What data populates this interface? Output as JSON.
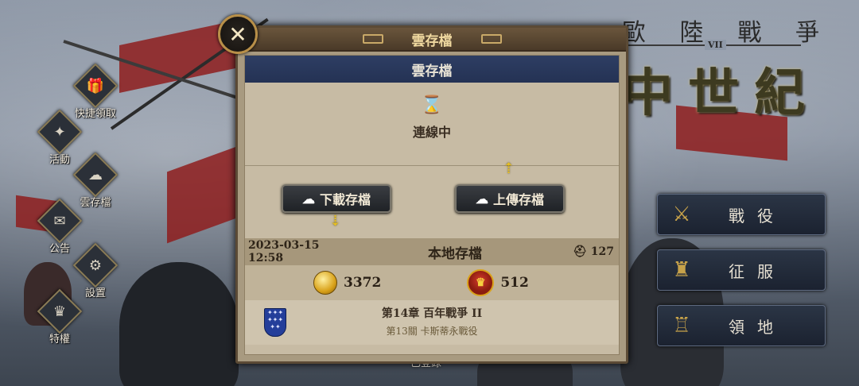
{
  "logo": {
    "subtitle_chars": [
      "歐",
      "陸",
      "戰",
      "爭"
    ],
    "numeral": "VII",
    "main_chars": [
      "中",
      "世",
      "紀"
    ]
  },
  "side_menu": [
    {
      "label": "快捷領取",
      "icon": "gift-icon",
      "glyph": "🎁"
    },
    {
      "label": "活動",
      "icon": "bag-icon",
      "glyph": "✦"
    },
    {
      "label": "雲存檔",
      "icon": "cloud-upload-icon",
      "glyph": "☁"
    },
    {
      "label": "公告",
      "icon": "envelope-icon",
      "glyph": "✉"
    },
    {
      "label": "設置",
      "icon": "gear-icon",
      "glyph": "⚙"
    },
    {
      "label": "特權",
      "icon": "crown-icon",
      "glyph": "♛"
    }
  ],
  "right_buttons": [
    {
      "label": "戰役",
      "icon": "crossed-swords-icon",
      "glyph": "⚔"
    },
    {
      "label": "征服",
      "icon": "cannon-icon",
      "glyph": "♜"
    },
    {
      "label": "領地",
      "icon": "castle-icon",
      "glyph": "♖"
    }
  ],
  "panel": {
    "header_title": "雲存檔",
    "cloud_bar_title": "雲存檔",
    "status_icon": "hourglass-icon",
    "status_text": "連線中",
    "download_label": "下載存檔",
    "upload_label": "上傳存檔",
    "local": {
      "date": "2023-03-15 12:58",
      "title": "本地存檔",
      "count": "127",
      "coins": "3372",
      "medals": "512",
      "chapter": "第14章 百年戰爭 II",
      "level": "第13關 卡斯蒂永戰役"
    }
  },
  "registered_text": "已登錄",
  "colors": {
    "accent_gold": "#e8c020",
    "cloud_bar": "#2e3e63"
  }
}
